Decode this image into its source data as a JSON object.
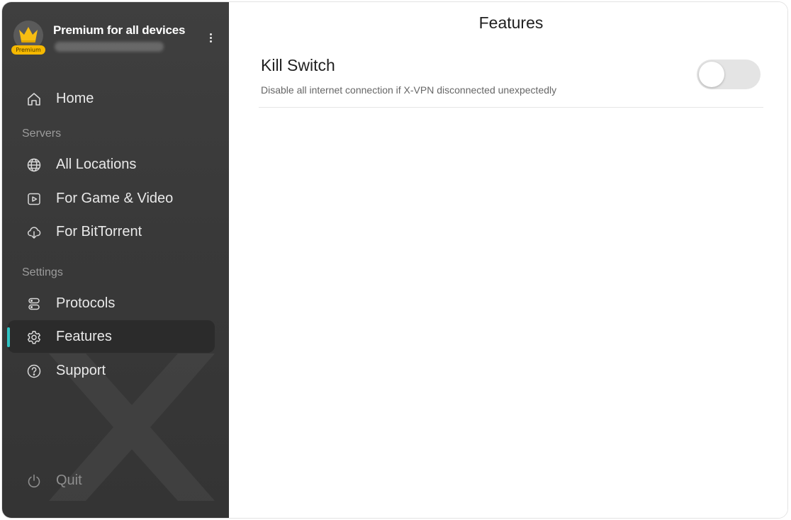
{
  "account": {
    "title": "Premium for all devices",
    "badge": "Premium",
    "avatar_icon": "crown-icon",
    "menu_icon": "more-vertical-icon"
  },
  "sidebar": {
    "home": {
      "label": "Home",
      "icon": "home-icon"
    },
    "servers_section": "Servers",
    "servers": [
      {
        "label": "All Locations",
        "icon": "globe-icon"
      },
      {
        "label": "For Game & Video",
        "icon": "play-icon"
      },
      {
        "label": "For BitTorrent",
        "icon": "cloud-download-icon"
      }
    ],
    "settings_section": "Settings",
    "settings": [
      {
        "label": "Protocols",
        "icon": "protocols-icon"
      },
      {
        "label": "Features",
        "icon": "gear-icon",
        "active": true
      },
      {
        "label": "Support",
        "icon": "help-icon"
      }
    ],
    "quit": {
      "label": "Quit",
      "icon": "power-icon"
    }
  },
  "main": {
    "title": "Features",
    "kill_switch": {
      "title": "Kill Switch",
      "description": "Disable all internet connection if X-VPN disconnected unexpectedly",
      "enabled": false
    }
  },
  "colors": {
    "sidebar_bg": "#3c3c3c",
    "active_item_bg": "#2b2b2b",
    "accent": "#2fc4c4",
    "badge": "#f5b800",
    "toggle_off": "#e4e4e4"
  }
}
